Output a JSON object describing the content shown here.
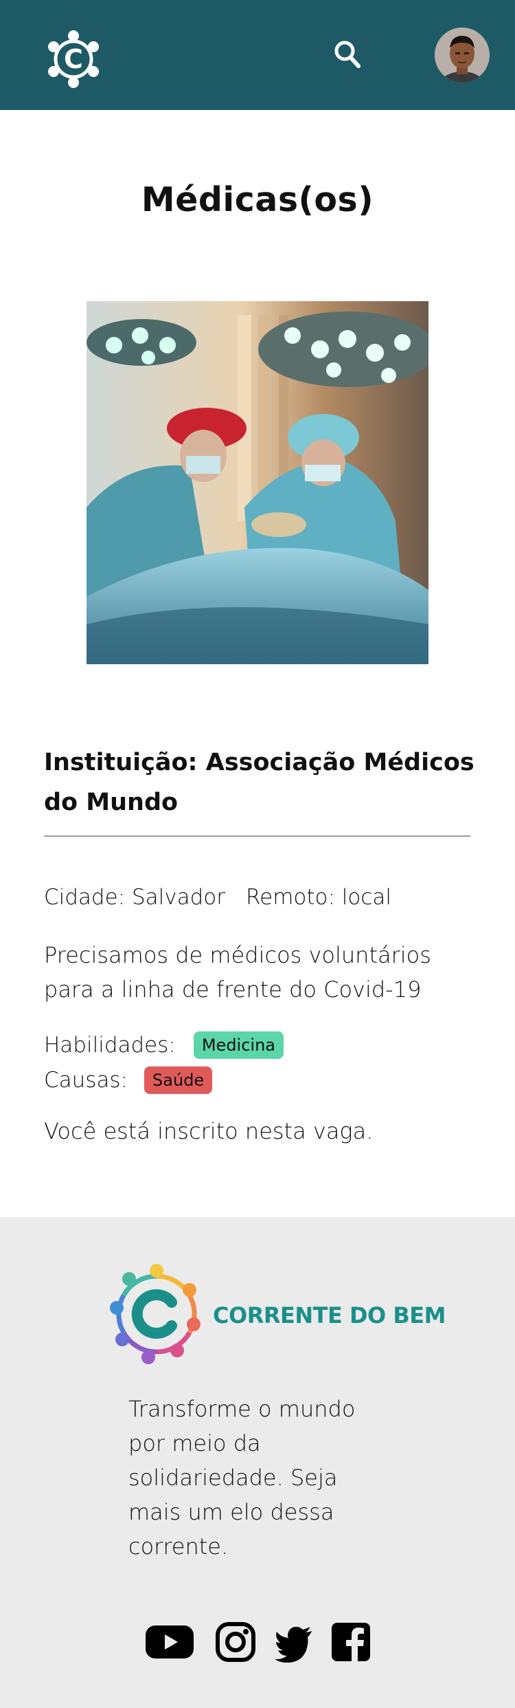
{
  "header": {
    "logo_icon": "corrente-c-logo-icon",
    "search_icon": "search-icon",
    "avatar_alt": "avatar"
  },
  "page": {
    "title": "Médicas(os)"
  },
  "opportunity": {
    "institution": "Instituição: Associação Médicos do Mundo",
    "city": "Cidade: Salvador",
    "remote": "Remoto: local",
    "description": "Precisamos de médicos voluntários para a linha de frente do Covid-19",
    "skills_label": "Habilidades:",
    "skills": [
      "Medicina"
    ],
    "causes_label": "Causas:",
    "causes": [
      "Saúde"
    ],
    "status": "Você está inscrito nesta vaga."
  },
  "footer": {
    "brand_name": "CORRENTE DO BEM",
    "tagline": "Transforme o mundo por meio da solidariedade. Seja mais um elo dessa corrente.",
    "social": [
      "youtube-icon",
      "instagram-icon",
      "twitter-icon",
      "facebook-icon"
    ]
  },
  "colors": {
    "header_bg": "#1d5a65",
    "skill_tag": "#5cd6a8",
    "cause_tag": "#e05a5a",
    "brand_teal": "#1a8f8a",
    "footer_bg": "#ebebeb"
  }
}
